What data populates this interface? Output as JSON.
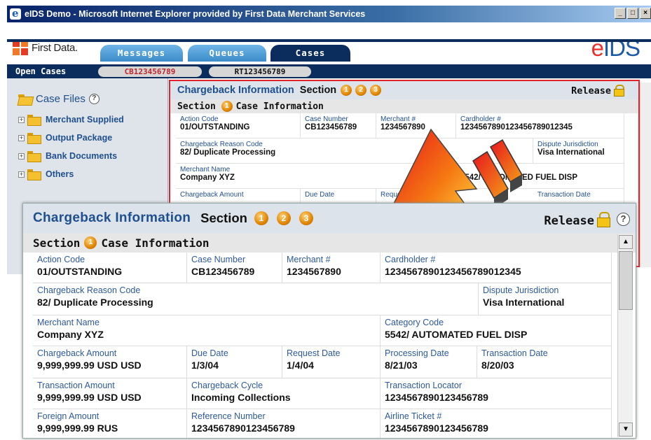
{
  "window": {
    "title": "eIDS Demo - Microsoft Internet Explorer provided by First Data Merchant Services",
    "controls": [
      "_",
      "□",
      "×"
    ]
  },
  "brand": {
    "company": "First Data.",
    "product_e": "e",
    "product_ids": "IDS"
  },
  "tabs": [
    {
      "label": "Messages",
      "active": false
    },
    {
      "label": "Queues",
      "active": false
    },
    {
      "label": "Cases",
      "active": true
    }
  ],
  "open_cases": {
    "label": "Open Cases",
    "items": [
      {
        "id": "CB123456789",
        "active": true
      },
      {
        "id": "RT123456789",
        "active": false
      }
    ]
  },
  "sidebar": {
    "title": "Case Files",
    "help": "?",
    "items": [
      {
        "label": "Merchant Supplied"
      },
      {
        "label": "Output Package"
      },
      {
        "label": "Bank Documents"
      },
      {
        "label": "Others"
      }
    ]
  },
  "panel": {
    "title": "Chargeback Information",
    "section_word": "Section",
    "section_numbers": [
      "1",
      "2",
      "3"
    ],
    "release": "Release",
    "help": "?",
    "section_header": {
      "word": "Section",
      "number": "1",
      "name": "Case Information"
    }
  },
  "background_fields": {
    "action_code": {
      "label": "Action Code",
      "value": "01/OUTSTANDING"
    },
    "case_number": {
      "label": "Case Number",
      "value": "CB123456789"
    },
    "merchant_no": {
      "label": "Merchant #",
      "value": "1234567890"
    },
    "cardholder_no": {
      "label": "Cardholder #",
      "value": "1234567890123456789012345"
    },
    "reason_code": {
      "label": "Chargeback Reason Code",
      "value": "82/ Duplicate Processing"
    },
    "dispute": {
      "label": "Dispute Jurisdiction",
      "value": "Visa International"
    },
    "merchant_name": {
      "label": "Merchant Name",
      "value": "Company XYZ"
    },
    "category_value": "5542/ AUTOMATED FUEL DISP",
    "cb_amount_label": "Chargeback Amount",
    "due_date_label": "Due Date",
    "request_label": "Request Date",
    "txn_date_label": "Transaction Date"
  },
  "fields": {
    "action_code": {
      "label": "Action Code",
      "value": "01/OUTSTANDING"
    },
    "case_number": {
      "label": "Case Number",
      "value": "CB123456789"
    },
    "merchant_no": {
      "label": "Merchant #",
      "value": "1234567890"
    },
    "cardholder_no": {
      "label": "Cardholder #",
      "value": "1234567890123456789012345"
    },
    "reason_code": {
      "label": "Chargeback Reason Code",
      "value": "82/ Duplicate Processing"
    },
    "dispute": {
      "label": "Dispute Jurisdiction",
      "value": "Visa International"
    },
    "merchant_name": {
      "label": "Merchant Name",
      "value": "Company XYZ"
    },
    "category_code": {
      "label": "Category Code",
      "value": "5542/ AUTOMATED FUEL DISP"
    },
    "cb_amount": {
      "label": "Chargeback Amount",
      "value": "9,999,999.99 USD  USD"
    },
    "due_date": {
      "label": "Due Date",
      "value": "1/3/04"
    },
    "request_date": {
      "label": "Request Date",
      "value": "1/4/04"
    },
    "processing_date": {
      "label": "Processing Date",
      "value": "8/21/03"
    },
    "transaction_date": {
      "label": "Transaction Date",
      "value": "8/20/03"
    },
    "txn_amount": {
      "label": "Transaction Amount",
      "value": "9,999,999.99 USD   USD"
    },
    "cb_cycle": {
      "label": "Chargeback Cycle",
      "value": "Incoming Collections"
    },
    "txn_locator": {
      "label": "Transaction Locator",
      "value": "1234567890123456789"
    },
    "foreign_amount": {
      "label": "Foreign Amount",
      "value": "9,999,999.99 RUS"
    },
    "reference_number": {
      "label": "Reference Number",
      "value": "1234567890123456789"
    },
    "airline_ticket": {
      "label": "Airline Ticket #",
      "value": "1234567890123456789"
    }
  },
  "colors": {
    "navy": "#0b2d5e",
    "link_blue": "#1f4f8f",
    "highlight_red": "#e4222b",
    "case_red": "#c0252b",
    "eids_red": "#e9322b",
    "eids_blue": "#1c5aa6"
  }
}
